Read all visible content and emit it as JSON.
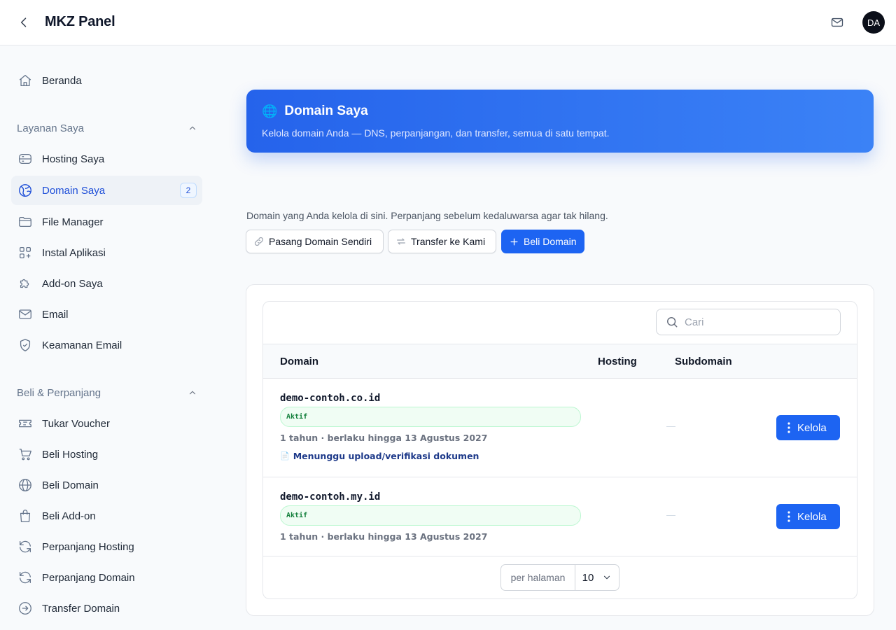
{
  "header": {
    "title": "MKZ Panel",
    "avatar_initials": "DA"
  },
  "sidebar": {
    "home": {
      "label": "Beranda",
      "icon": "home-icon"
    },
    "section_services": {
      "title": "Layanan Saya"
    },
    "services": [
      {
        "label": "Hosting Saya",
        "icon": "server-icon"
      },
      {
        "label": "Domain Saya",
        "icon": "globe-icon",
        "badge": "2",
        "active": true
      },
      {
        "label": "File Manager",
        "icon": "folder-icon"
      },
      {
        "label": "Instal Aplikasi",
        "icon": "apps-icon"
      },
      {
        "label": "Add-on Saya",
        "icon": "puzzle-icon"
      },
      {
        "label": "Email",
        "icon": "mail-icon"
      },
      {
        "label": "Keamanan Email",
        "icon": "shield-icon"
      }
    ],
    "section_buy": {
      "title": "Beli & Perpanjang"
    },
    "buy": [
      {
        "label": "Tukar Voucher",
        "icon": "ticket-icon"
      },
      {
        "label": "Beli Hosting",
        "icon": "cart-icon"
      },
      {
        "label": "Beli Domain",
        "icon": "globe-icon"
      },
      {
        "label": "Beli Add-on",
        "icon": "bag-icon"
      },
      {
        "label": "Perpanjang Hosting",
        "icon": "refresh-icon"
      },
      {
        "label": "Perpanjang Domain",
        "icon": "refresh-icon"
      },
      {
        "label": "Transfer Domain",
        "icon": "arrow-circle-icon"
      }
    ]
  },
  "hero": {
    "emoji": "🌐",
    "title": "Domain Saya",
    "subtitle": "Kelola domain Anda — DNS, perpanjangan, dan transfer, semua di satu tempat."
  },
  "intro": "Domain yang Anda kelola di sini. Perpanjang sebelum kedaluwarsa agar tak hilang.",
  "actions": {
    "attach": "Pasang Domain Sendiri",
    "transfer": "Transfer ke Kami",
    "buy": "Beli Domain"
  },
  "search": {
    "placeholder": "Cari"
  },
  "table": {
    "columns": {
      "domain": "Domain",
      "hosting": "Hosting",
      "subdomain": "Subdomain"
    },
    "rows": [
      {
        "domain": "demo-contoh.co.id",
        "status": "Aktif",
        "term": "1 tahun · berlaku hingga 13 Agustus 2027",
        "doc_icon": "📄",
        "note": "Menunggu upload/verifikasi dokumen",
        "subdomain": "—",
        "action": "Kelola"
      },
      {
        "domain": "demo-contoh.my.id",
        "status": "Aktif",
        "term": "1 tahun · berlaku hingga 13 Agustus 2027",
        "subdomain": "—",
        "action": "Kelola"
      }
    ]
  },
  "pagination": {
    "per_page_label": "per halaman",
    "per_page_value": "10"
  },
  "colors": {
    "primary": "#1d64f2",
    "hero_start": "#2563eb",
    "hero_end": "#3b82f6",
    "status_green": "#15803d"
  }
}
